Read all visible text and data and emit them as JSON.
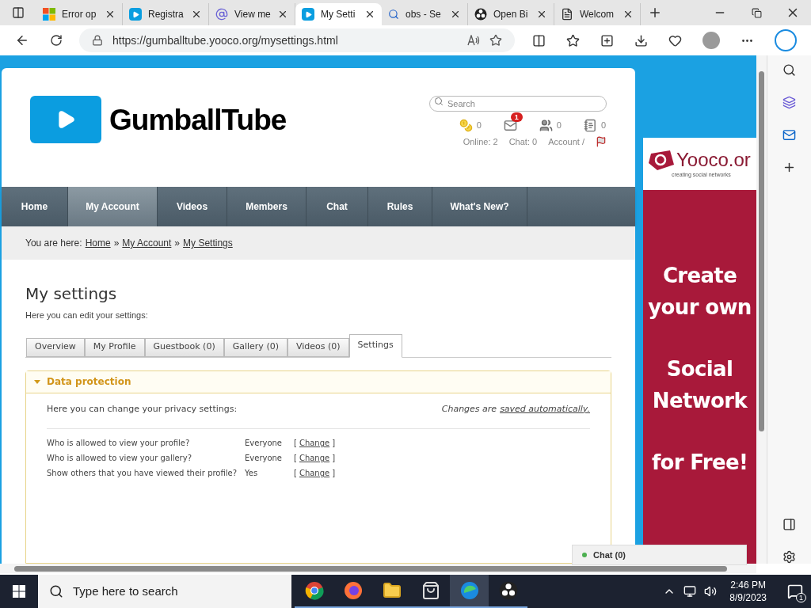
{
  "browser": {
    "tabs": [
      {
        "label": "Error op",
        "kind": "windows",
        "selected": false
      },
      {
        "label": "Registra",
        "kind": "play",
        "selected": false
      },
      {
        "label": "View me",
        "kind": "at",
        "selected": false
      },
      {
        "label": "My Setti",
        "kind": "play",
        "selected": true
      },
      {
        "label": "obs - Se",
        "kind": "search",
        "selected": false
      },
      {
        "label": "Open Bi",
        "kind": "obs",
        "selected": false
      },
      {
        "label": "Welcom",
        "kind": "page",
        "selected": false
      }
    ],
    "address": "https://gumballtube.yooco.org/mysettings.html"
  },
  "site": {
    "logo": "GumballTube",
    "search": {
      "placeholder": "Search"
    },
    "stats": [
      {
        "kind": "coins",
        "count": "0"
      },
      {
        "kind": "mail",
        "badge": "1"
      },
      {
        "kind": "users",
        "count": "0"
      },
      {
        "kind": "notebook",
        "count": "0"
      }
    ],
    "status_links": [
      "Online: 2",
      "Chat: 0",
      "Account /"
    ]
  },
  "nav": [
    {
      "label": "Home",
      "selected": false
    },
    {
      "label": "My Account",
      "selected": true
    },
    {
      "label": "Videos",
      "selected": false
    },
    {
      "label": "Members",
      "selected": false
    },
    {
      "label": "Chat",
      "selected": false
    },
    {
      "label": "Rules",
      "selected": false
    },
    {
      "label": "What's New?",
      "selected": false
    }
  ],
  "breadcrumb": {
    "label": "You are here:",
    "links": [
      "Home",
      "My Account",
      "My Settings"
    ],
    "separators": [
      "»",
      "»"
    ]
  },
  "page": {
    "title": "My settings",
    "subtitle": "Here you can edit your settings:",
    "tabs": [
      {
        "label": "Overview",
        "selected": false
      },
      {
        "label": "My Profile",
        "selected": false
      },
      {
        "label": "Guestbook (0)",
        "selected": false
      },
      {
        "label": "Gallery (0)",
        "selected": false
      },
      {
        "label": "Videos (0)",
        "selected": false
      },
      {
        "label": "Settings",
        "selected": true
      }
    ],
    "section": {
      "title": "Data protection",
      "expanded": true,
      "intro": "Here you can change your privacy settings:",
      "note": "Changes are",
      "note_link": "saved automatically.",
      "rows": [
        {
          "question": "Who is allowed to view your profile?",
          "value": "Everyone",
          "open": "[",
          "action": "Change",
          "close": "]"
        },
        {
          "question": "Who is allowed to view your gallery?",
          "value": "Everyone",
          "open": "[",
          "action": "Change",
          "close": "]"
        },
        {
          "question": "Show others that you have viewed their profile?",
          "value": "Yes",
          "open": "[",
          "action": "Change",
          "close": "]"
        }
      ]
    }
  },
  "ad": {
    "brand": "Yooco.or",
    "tagline": "creating social networks",
    "lines": [
      "Create",
      "your own",
      "Social",
      "Network",
      "for Free!"
    ]
  },
  "chat": {
    "label": "Chat (0)"
  },
  "taskbar": {
    "search_placeholder": "Type here to search",
    "apps": [
      {
        "kind": "chrome",
        "selected": false
      },
      {
        "kind": "firefox",
        "selected": false
      },
      {
        "kind": "explorer",
        "selected": false
      },
      {
        "kind": "store",
        "selected": false
      },
      {
        "kind": "edge",
        "selected": true
      },
      {
        "kind": "obs",
        "selected": false
      }
    ],
    "time": "2:46 PM",
    "date": "8/9/2023",
    "notifications": "1"
  }
}
